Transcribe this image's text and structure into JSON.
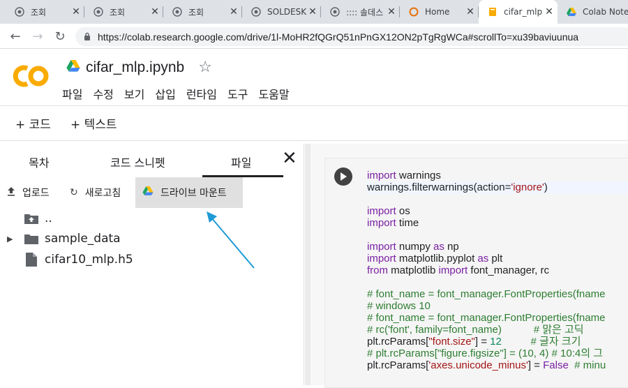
{
  "browser": {
    "tabs": [
      {
        "title": "조회",
        "icon": "globe-icon",
        "active": false
      },
      {
        "title": "조회",
        "icon": "globe-icon",
        "active": false
      },
      {
        "title": "조회",
        "icon": "globe-icon",
        "active": false
      },
      {
        "title": "SOLDESK",
        "icon": "globe-icon",
        "active": false
      },
      {
        "title": ":::: 솔데스",
        "icon": "globe-icon",
        "active": false
      },
      {
        "title": "Home",
        "icon": "orange-ring-icon",
        "active": false
      },
      {
        "title": "cifar_mlp",
        "icon": "colab-notebook-icon",
        "active": true
      },
      {
        "title": "Colab Note",
        "icon": "drive-icon",
        "active": false
      }
    ],
    "url": "https://colab.research.google.com/drive/1l-MoHR2fQGrQ51nPnGX12ON2pTgRgWCa#scrollTo=xu39baviuunua"
  },
  "colab": {
    "logo_text": "CO",
    "notebook_title": "cifar_mlp.ipynb",
    "menu": [
      "파일",
      "수정",
      "보기",
      "삽입",
      "런타임",
      "도구",
      "도움말"
    ],
    "toolbar": {
      "add_code": "+ 코드",
      "add_text": "+ 텍스트"
    }
  },
  "sidebar": {
    "tabs": [
      "목차",
      "코드 스니펫",
      "파일"
    ],
    "active_tab": "파일",
    "actions": {
      "upload": "업로드",
      "refresh": "새로고침",
      "mount_drive": "드라이브 마운트"
    },
    "files": [
      {
        "name": "..",
        "icon": "folder-up-icon"
      },
      {
        "name": "sample_data",
        "icon": "folder-icon",
        "expandable": true
      },
      {
        "name": "cifar10_mlp.h5",
        "icon": "file-icon"
      }
    ]
  },
  "code_lines": [
    [
      {
        "t": "import",
        "c": "kw"
      },
      {
        "t": " warnings",
        "c": ""
      }
    ],
    [
      {
        "t": "warnings.filterwarnings(action=",
        "c": ""
      },
      {
        "t": "'ignore'",
        "c": "st"
      },
      {
        "t": ")",
        "c": ""
      }
    ],
    [],
    [
      {
        "t": "import",
        "c": "kw"
      },
      {
        "t": " os",
        "c": ""
      }
    ],
    [
      {
        "t": "import",
        "c": "kw"
      },
      {
        "t": " time",
        "c": ""
      }
    ],
    [],
    [
      {
        "t": "import",
        "c": "kw"
      },
      {
        "t": " numpy ",
        "c": ""
      },
      {
        "t": "as",
        "c": "kw"
      },
      {
        "t": " np",
        "c": ""
      }
    ],
    [
      {
        "t": "import",
        "c": "kw"
      },
      {
        "t": " matplotlib.pyplot ",
        "c": ""
      },
      {
        "t": "as",
        "c": "kw"
      },
      {
        "t": " plt",
        "c": ""
      }
    ],
    [
      {
        "t": "from",
        "c": "kw"
      },
      {
        "t": " matplotlib ",
        "c": ""
      },
      {
        "t": "import",
        "c": "kw"
      },
      {
        "t": " font_manager, rc",
        "c": ""
      }
    ],
    [],
    [
      {
        "t": "# font_name = font_manager.FontProperties(fname",
        "c": "cm"
      }
    ],
    [
      {
        "t": "# windows 10",
        "c": "cm"
      }
    ],
    [
      {
        "t": "# font_name = font_manager.FontProperties(fname",
        "c": "cm"
      }
    ],
    [
      {
        "t": "# rc('font', family=font_name)           # 맑은 고딕",
        "c": "cm"
      }
    ],
    [
      {
        "t": "plt.rcParams[",
        "c": ""
      },
      {
        "t": "\"font.size\"",
        "c": "st"
      },
      {
        "t": "] = ",
        "c": ""
      },
      {
        "t": "12",
        "c": "nm"
      },
      {
        "t": "          ",
        "c": ""
      },
      {
        "t": "# 글자 크기",
        "c": "cm"
      }
    ],
    [
      {
        "t": "# plt.rcParams[\"figure.figsize\"] = (10, 4) # 10:4의 그",
        "c": "cm"
      }
    ],
    [
      {
        "t": "plt.rcParams[",
        "c": ""
      },
      {
        "t": "'axes.unicode_minus'",
        "c": "st"
      },
      {
        "t": "] = ",
        "c": ""
      },
      {
        "t": "False",
        "c": "kw"
      },
      {
        "t": "  ",
        "c": ""
      },
      {
        "t": "# minu",
        "c": "cm"
      }
    ]
  ]
}
